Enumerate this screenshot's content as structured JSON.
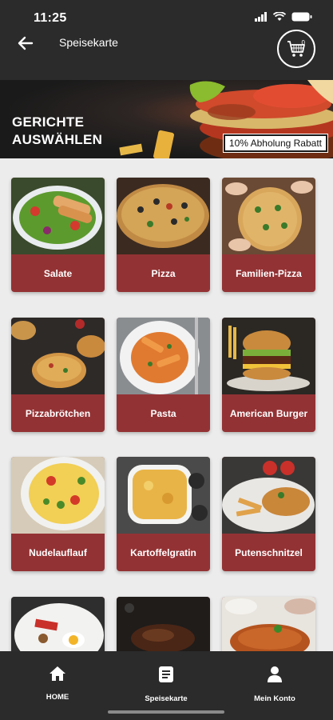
{
  "status_bar": {
    "time": "11:25"
  },
  "header": {
    "title": "Speisekarte",
    "cart_count": "0"
  },
  "banner": {
    "title_line1": "GERICHTE",
    "title_line2": "AUSWÄHLEN",
    "badge": "10% Abholung Rabatt"
  },
  "categories": [
    {
      "label": "Salate",
      "icon": "salad-image"
    },
    {
      "label": "Pizza",
      "icon": "pizza-image"
    },
    {
      "label": "Familien-Pizza",
      "icon": "family-pizza-image"
    },
    {
      "label": "Pizzabrötchen",
      "icon": "pizza-rolls-image"
    },
    {
      "label": "Pasta",
      "icon": "pasta-image"
    },
    {
      "label": "American Burger",
      "icon": "burger-image"
    },
    {
      "label": "Nudelauflauf",
      "icon": "noodle-casserole-image"
    },
    {
      "label": "Kartoffelgratin",
      "icon": "potato-gratin-image"
    },
    {
      "label": "Putenschnitzel",
      "icon": "turkey-schnitzel-image"
    }
  ],
  "bottom_nav": {
    "home": "HOME",
    "menu": "Speisekarte",
    "account": "Mein Konto"
  }
}
